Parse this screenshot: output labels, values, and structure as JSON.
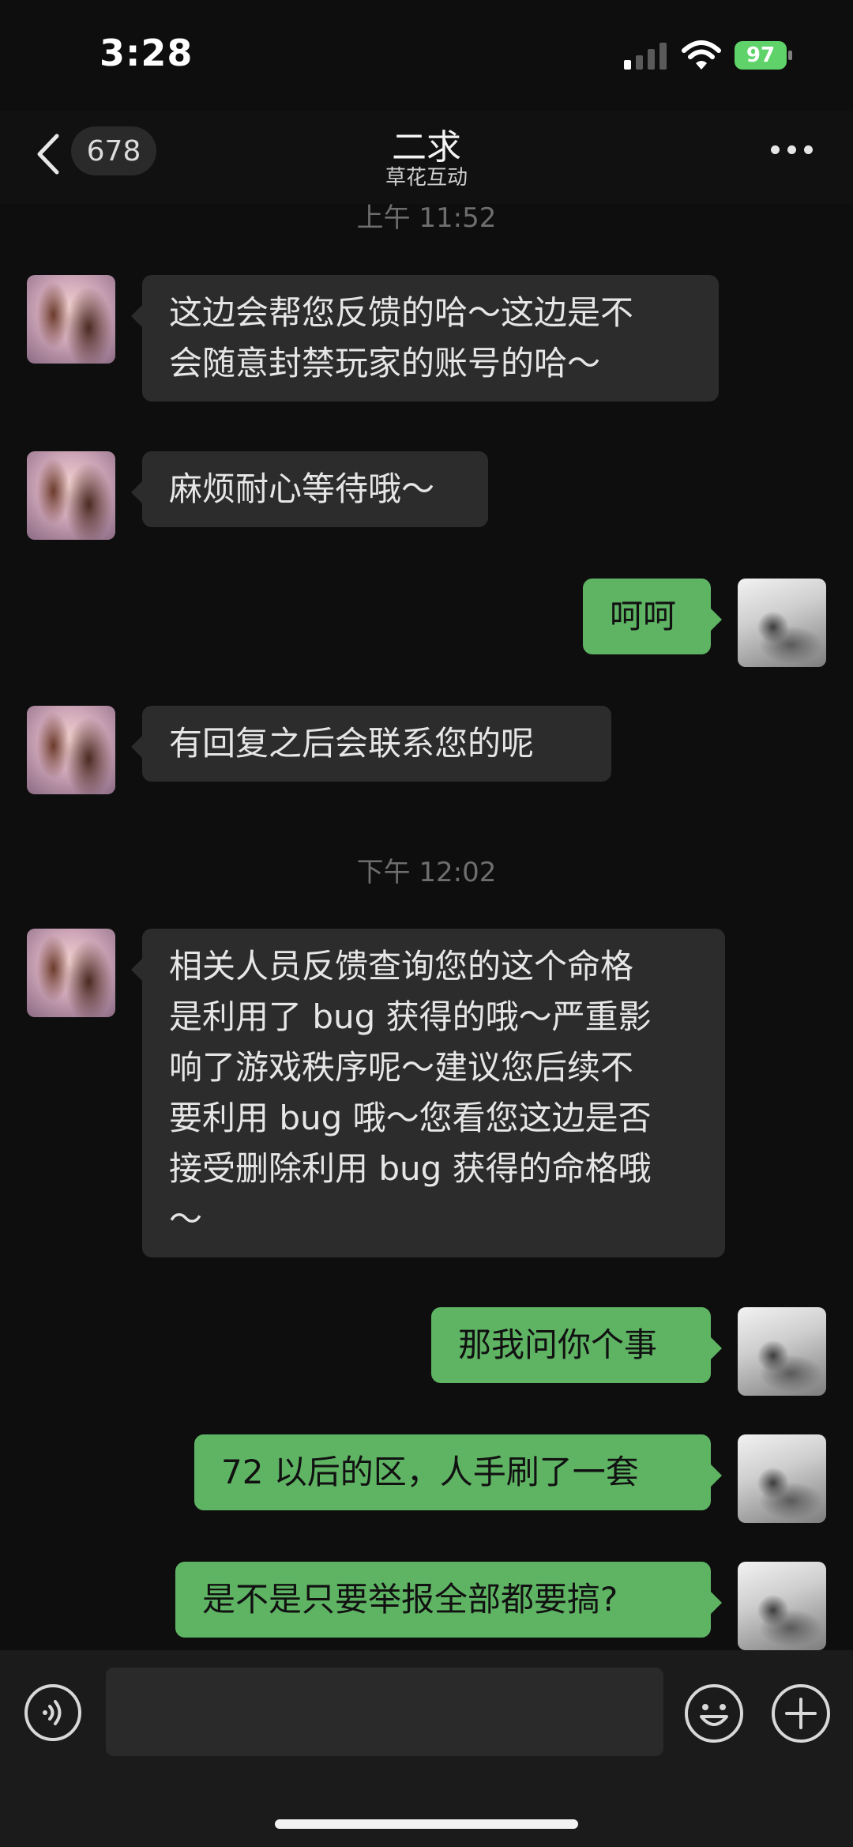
{
  "status_bar": {
    "time": "3:28",
    "battery": "97"
  },
  "header": {
    "unread_count": "678",
    "title": "二求",
    "subtitle": "草花互动"
  },
  "timestamps": {
    "t1": "上午 11:52",
    "t2": "下午 12:02"
  },
  "messages": [
    {
      "sender": "them",
      "text": "这边会帮您反馈的哈～这边是不\n会随意封禁玩家的账号的哈～"
    },
    {
      "sender": "them",
      "text": "麻烦耐心等待哦～"
    },
    {
      "sender": "me",
      "text": "呵呵"
    },
    {
      "sender": "them",
      "text": "有回复之后会联系您的呢"
    },
    {
      "sender": "them",
      "text": "相关人员反馈查询您的这个命格\n是利用了 bug 获得的哦～严重影\n响了游戏秩序呢～建议您后续不\n要利用 bug 哦～您看您这边是否\n接受删除利用 bug 获得的命格哦\n～"
    },
    {
      "sender": "me",
      "text": "那我问你个事"
    },
    {
      "sender": "me",
      "text": "72 以后的区，人手刷了一套"
    },
    {
      "sender": "me",
      "text": "是不是只要举报全部都要搞?"
    }
  ],
  "colors": {
    "background": "#0e0e0e",
    "incoming_bubble": "#2c2c2c",
    "outgoing_bubble": "#5fb464",
    "battery": "#5fd36a"
  },
  "icons": [
    "back-icon",
    "more-icon",
    "voice-icon",
    "emoji-icon",
    "plus-icon",
    "signal-icon",
    "wifi-icon",
    "battery-icon"
  ]
}
